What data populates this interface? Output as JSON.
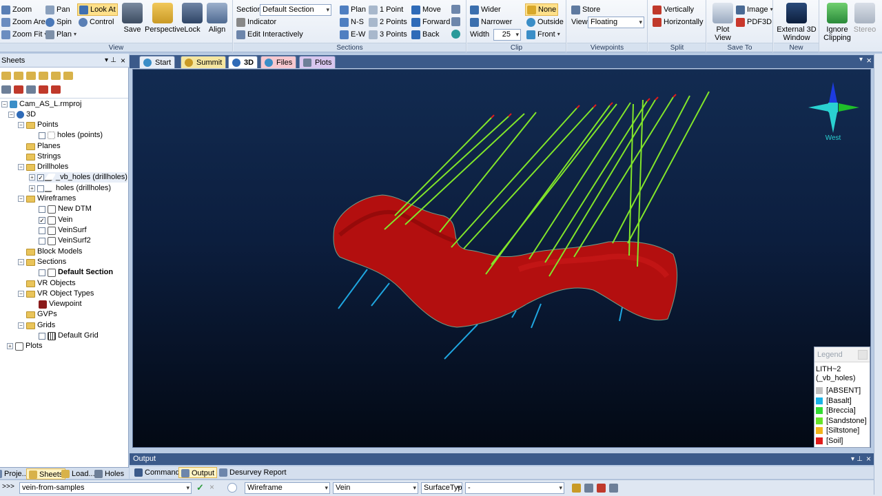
{
  "ribbon": {
    "view": {
      "label": "View",
      "zoom": "Zoom",
      "zoom_area": "Zoom Area",
      "zoom_fit": "Zoom Fit",
      "pan": "Pan",
      "spin": "Spin",
      "plan": "Plan",
      "look_at": "Look At",
      "control": "Control",
      "save": "Save",
      "perspective": "Perspective",
      "lock": "Lock",
      "align": "Align"
    },
    "sections": {
      "label": "Sections",
      "section_caption": "Section",
      "section_value": "Default Section",
      "indicator": "Indicator",
      "edit_interactively": "Edit Interactively",
      "plan": "Plan",
      "ns": "N-S",
      "ew": "E-W",
      "one_point": "1 Point",
      "two_points": "2 Points",
      "three_points": "3 Points",
      "move": "Move",
      "forward": "Forward",
      "back": "Back"
    },
    "clip": {
      "label": "Clip",
      "wider": "Wider",
      "narrower": "Narrower",
      "width_caption": "Width",
      "width_value": "25",
      "none": "None",
      "outside": "Outside",
      "front": "Front"
    },
    "viewpoints": {
      "label": "Viewpoints",
      "store": "Store",
      "view_caption": "View",
      "view_value": "Floating"
    },
    "split": {
      "label": "Split",
      "vertically": "Vertically",
      "horizontally": "Horizontally"
    },
    "save_to": {
      "label": "Save To",
      "plot_view": "Plot View",
      "image": "Image",
      "pdf3d": "PDF3D"
    },
    "new": {
      "label": "New",
      "external_3d_window": "External 3D Window"
    },
    "other": {
      "ignore_clipping": "Ignore Clipping",
      "stereo": "Stereo"
    }
  },
  "sheets_panel": {
    "title": "Sheets",
    "tree": {
      "project": "Cam_AS_L.rmproj",
      "view3d": "3D",
      "points": "Points",
      "holes_points": "holes (points)",
      "planes": "Planes",
      "strings": "Strings",
      "drillholes": "Drillholes",
      "vb_holes": "_vb_holes (drillholes)",
      "holes_drillholes": "holes (drillholes)",
      "wireframes": "Wireframes",
      "new_dtm": "New DTM",
      "vein": "Vein",
      "veinsurf": "VeinSurf",
      "veinsurf2": "VeinSurf2",
      "block_models": "Block Models",
      "sections": "Sections",
      "default_section": "Default Section",
      "vr_objects": "VR Objects",
      "vr_object_types": "VR Object Types",
      "viewpoint": "Viewpoint",
      "gvps": "GVPs",
      "grids": "Grids",
      "default_grid": "Default Grid",
      "plots": "Plots"
    },
    "bottom_tabs": {
      "projects": "Proje...",
      "sheets": "Sheets",
      "loads": "Load...",
      "holes": "Holes"
    }
  },
  "document_tabs": {
    "start": "Start",
    "summit": "Summit",
    "view3d": "3D",
    "files": "Files",
    "plots": "Plots"
  },
  "compass": {
    "label": "West"
  },
  "legend": {
    "title": "Legend",
    "field": "LITH~2",
    "source": "(_vb_holes)",
    "items": [
      {
        "label": "[ABSENT]",
        "color": "#c0c0c0"
      },
      {
        "label": "[Basalt]",
        "color": "#19b3e6"
      },
      {
        "label": "[Breccia]",
        "color": "#33dd33"
      },
      {
        "label": "[Sandstone]",
        "color": "#66e52a"
      },
      {
        "label": "[Siltstone]",
        "color": "#f2b51b"
      },
      {
        "label": "[Soil]",
        "color": "#e01b1b"
      }
    ]
  },
  "output": {
    "title": "Output",
    "tabs": {
      "command": "Command",
      "output": "Output",
      "desurvey": "Desurvey Report"
    }
  },
  "command_bar": {
    "prompt": ">>>",
    "command_value": "vein-from-samples",
    "type_value": "Wireframe",
    "name_value": "Vein",
    "attr_value": "SurfaceTyp",
    "extra_value": "-"
  }
}
